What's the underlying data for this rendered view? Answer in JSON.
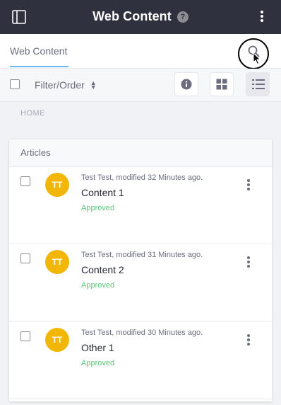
{
  "header": {
    "title": "Web Content",
    "help_icon": "?",
    "sidebar_toggle_icon": "sidebar-toggle-icon",
    "options_icon": "kebab-icon"
  },
  "nav": {
    "tab_label": "Web Content",
    "search_icon": "search-icon"
  },
  "toolbar": {
    "filter_label": "Filter/Order",
    "sort_icon": "sort-icon",
    "info_icon": "info-icon",
    "cards_icon": "cards-view-icon",
    "list_icon": "list-view-icon"
  },
  "breadcrumb": "HOME",
  "articles": {
    "heading": "Articles",
    "items": [
      {
        "avatar": "TT",
        "meta": "Test Test, modified 32 Minutes ago.",
        "title": "Content 1",
        "status": "Approved"
      },
      {
        "avatar": "TT",
        "meta": "Test Test, modified 31 Minutes ago.",
        "title": "Content 2",
        "status": "Approved"
      },
      {
        "avatar": "TT",
        "meta": "Test Test, modified 30 Minutes ago.",
        "title": "Other 1",
        "status": "Approved"
      }
    ]
  },
  "colors": {
    "header_bg": "#30313f",
    "accent": "#65b6f0",
    "avatar": "#f2b706",
    "approved": "#5aca75"
  }
}
